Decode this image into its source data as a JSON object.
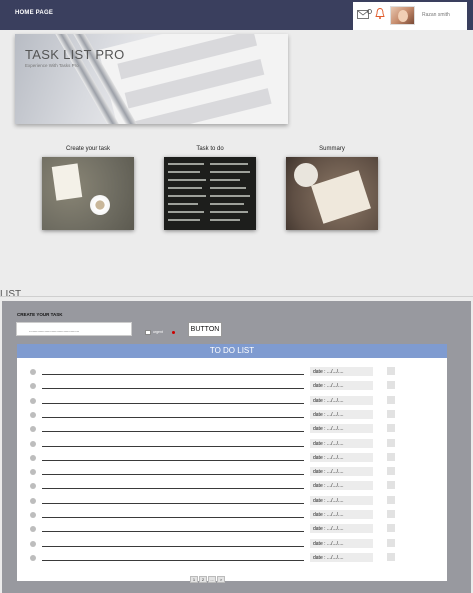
{
  "topbar": {
    "home_label": "HOME PAGE",
    "user_name": "Razan smith"
  },
  "hero": {
    "title": "TASK LIST PRO",
    "subtitle": "Experience With Tasks Pro"
  },
  "cards": [
    {
      "label": "Create your task",
      "image": "notebook-coffee-image"
    },
    {
      "label": "Task to do",
      "image": "chalkboard-image"
    },
    {
      "label": "Summary",
      "image": "desk-notes-image"
    }
  ],
  "list_section": {
    "title": "LIST"
  },
  "create": {
    "label": "CREATE YOUR TASK",
    "input_value": "..........................................",
    "urgent_label": "urgent",
    "button_label": "BUTTON"
  },
  "todo": {
    "header": "TO DO  LIST",
    "rows": [
      {
        "date": "date : .../.../...."
      },
      {
        "date": "date : .../.../...."
      },
      {
        "date": "date : .../.../...."
      },
      {
        "date": "date : .../.../...."
      },
      {
        "date": "date : .../.../...."
      },
      {
        "date": "date : .../.../...."
      },
      {
        "date": "date : .../.../...."
      },
      {
        "date": "date : .../.../...."
      },
      {
        "date": "date : .../.../...."
      },
      {
        "date": "date : .../.../...."
      },
      {
        "date": "date : .../.../...."
      },
      {
        "date": "date : .../.../...."
      },
      {
        "date": "date : .../.../...."
      },
      {
        "date": "date : .../.../...."
      }
    ],
    "pagination": [
      "1",
      "2",
      "...",
      ">"
    ]
  },
  "colors": {
    "topbar": "#3a3f5e",
    "panel": "#98999f",
    "todo_header": "#7f9bd0",
    "urgent_dot": "#cc0000"
  }
}
